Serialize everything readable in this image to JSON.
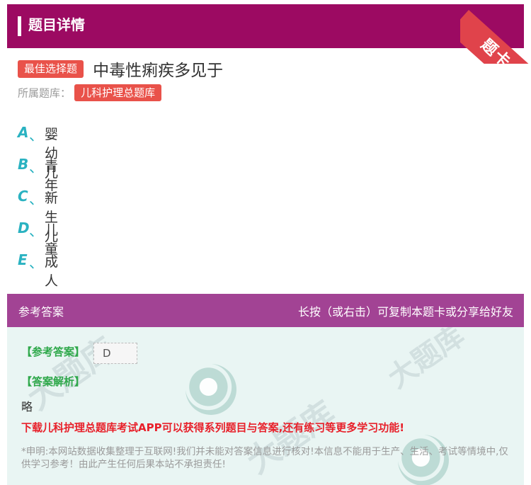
{
  "header": {
    "title": "题目详情",
    "ribbon": "题卡"
  },
  "question": {
    "type_badge": "最佳选择题",
    "text": "中毒性痢疾多见于",
    "bank_label": "所属题库：",
    "bank_name": "儿科护理总题库"
  },
  "options": [
    {
      "letter": "A",
      "sep": "、",
      "text": "婴幼儿"
    },
    {
      "letter": "B",
      "sep": "、",
      "text": "青年"
    },
    {
      "letter": "C",
      "sep": "、",
      "text": "新生儿"
    },
    {
      "letter": "D",
      "sep": "、",
      "text": "儿童"
    },
    {
      "letter": "E",
      "sep": "、",
      "text": "成人"
    }
  ],
  "answer_bar": {
    "left": "参考答案",
    "right": "长按（或右击）可复制本题卡或分享给好友"
  },
  "answer": {
    "answer_label": "【参考答案】",
    "answer_value": "D",
    "analysis_label": "【答案解析】",
    "analysis_value": "略",
    "download_text": "下载儿科护理总题库考试APP可以获得系列题目与答案,还有练习等更多学习功能!",
    "disclaimer": "*申明:本网站数据收集整理于互联网!我们并未能对答案信息进行核对!本信息不能用于生产、生活、考试等情境中,仅供学习参考！由此产生任何后果本站不承担责任!"
  },
  "colors": {
    "header_bg": "#9c0a62",
    "answer_bar_bg": "#a24394",
    "badge_bg": "#e9524a",
    "option_letter": "#2ab2c1",
    "answer_label": "#2ea84a",
    "download_text": "#e8202a"
  }
}
